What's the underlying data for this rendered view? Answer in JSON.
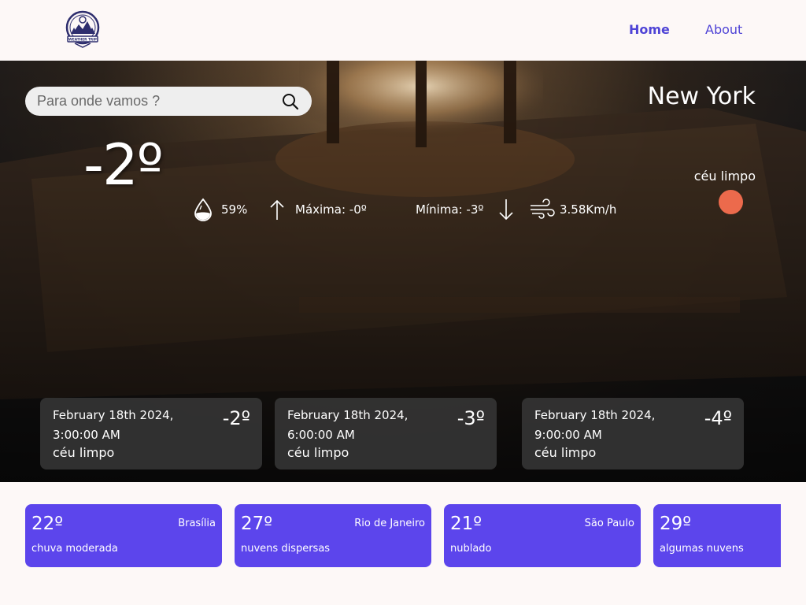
{
  "navbar": {
    "logo_icon": "weather-trip-logo",
    "logo_text": "WEATHER TRIP",
    "links": [
      {
        "label": "Home",
        "active": true
      },
      {
        "label": "About",
        "active": false
      }
    ],
    "link_color": "#4f44d6"
  },
  "search": {
    "placeholder": "Para onde vamos ?",
    "value": "",
    "icon": "search-icon"
  },
  "current": {
    "temperature": "-2º",
    "city": "New York",
    "description": "céu limpo",
    "sun_color": "#ec6a4c",
    "humidity": "59%",
    "max": "Máxima: -0º",
    "min": "Mínima: -3º",
    "wind": "3.58Km/h",
    "icons": {
      "humidity": "water-drop-icon",
      "max": "arrow-up-icon",
      "min": "arrow-down-icon",
      "wind": "wind-icon"
    }
  },
  "forecast": [
    {
      "date_line1": "February 18th 2024,",
      "date_line2": "3:00:00 AM",
      "description": "céu limpo",
      "temp": "-2º"
    },
    {
      "date_line1": "February 18th 2024,",
      "date_line2": "6:00:00 AM",
      "description": "céu limpo",
      "temp": "-3º"
    },
    {
      "date_line1": "February 18th 2024,",
      "date_line2": "9:00:00 AM",
      "description": "céu limpo",
      "temp": "-4º"
    }
  ],
  "cities": [
    {
      "temp": "22º",
      "name": "Brasília",
      "description": "chuva moderada"
    },
    {
      "temp": "27º",
      "name": "Rio de Janeiro",
      "description": "nuvens dispersas"
    },
    {
      "temp": "21º",
      "name": "São Paulo",
      "description": "nublado"
    },
    {
      "temp": "29º",
      "name": "",
      "description": "algumas nuvens"
    }
  ],
  "colors": {
    "page_bg": "#fdf8f7",
    "city_card": "#5c45ec",
    "forecast_card": "#343434"
  }
}
